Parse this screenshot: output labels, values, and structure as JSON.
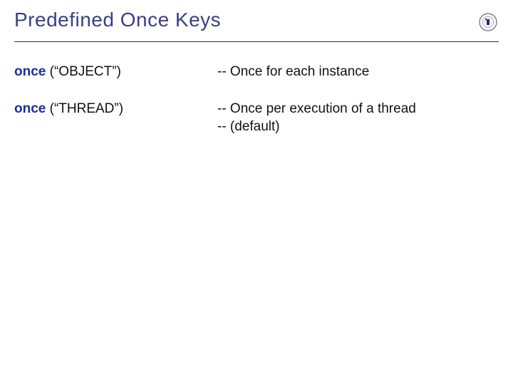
{
  "title": "Predefined Once Keys",
  "rows": [
    {
      "keyword": "once",
      "arg": " (“OBJECT”)",
      "comment": "-- Once for each instance"
    },
    {
      "keyword": "once",
      "arg": " (“THREAD”)",
      "comment": "-- Once per execution of a thread\n-- (default)"
    }
  ]
}
